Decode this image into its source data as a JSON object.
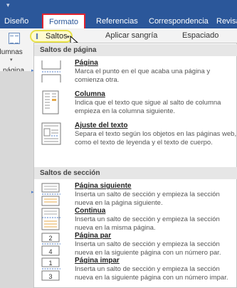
{
  "tabs": [
    {
      "label": "Diseño",
      "active": false
    },
    {
      "label": "Formato",
      "active": true
    },
    {
      "label": "Referencias",
      "active": false
    },
    {
      "label": "Correspondencia",
      "active": false
    },
    {
      "label": "Revisa",
      "active": false
    }
  ],
  "ribbon": {
    "left_label_1": "olumnas",
    "left_label_2": "página",
    "saltos_label": "Saltos",
    "indent_label": "Aplicar sangría",
    "spacing_label": "Espaciado"
  },
  "menu": {
    "page_breaks_header": "Saltos de página",
    "section_breaks_header": "Saltos de sección",
    "items": [
      {
        "title": "Página",
        "desc": "Marca el punto en el que acaba una página y comienza otra."
      },
      {
        "title": "Columna",
        "desc": "Indica que el texto que sigue al salto de columna empieza en la columna siguiente."
      },
      {
        "title": "Ajuste del texto",
        "desc": "Separa el texto según los objetos en las páginas web, como el texto de leyenda y el texto de cuerpo."
      },
      {
        "title": "Página siguiente",
        "desc": "Inserta un salto de sección y empieza la sección nueva en la página siguiente."
      },
      {
        "title": "Continua",
        "desc": "Inserta un salto de sección y empieza la sección nueva en la misma página."
      },
      {
        "title": "Página par",
        "desc": "Inserta un salto de sección y empieza la sección nueva en la siguiente página con un número par."
      },
      {
        "title": "Página impar",
        "desc": "Inserta un salto de sección y empieza la sección nueva en la siguiente página con un número impar."
      }
    ],
    "icon_labels": {
      "even_top": "2",
      "even_bottom": "4",
      "odd_top": "1",
      "odd_bottom": "3"
    }
  },
  "colors": {
    "ribbon_blue": "#2b579a",
    "highlight_red": "#e0232f",
    "highlight_yellow": "#e8e24a"
  }
}
